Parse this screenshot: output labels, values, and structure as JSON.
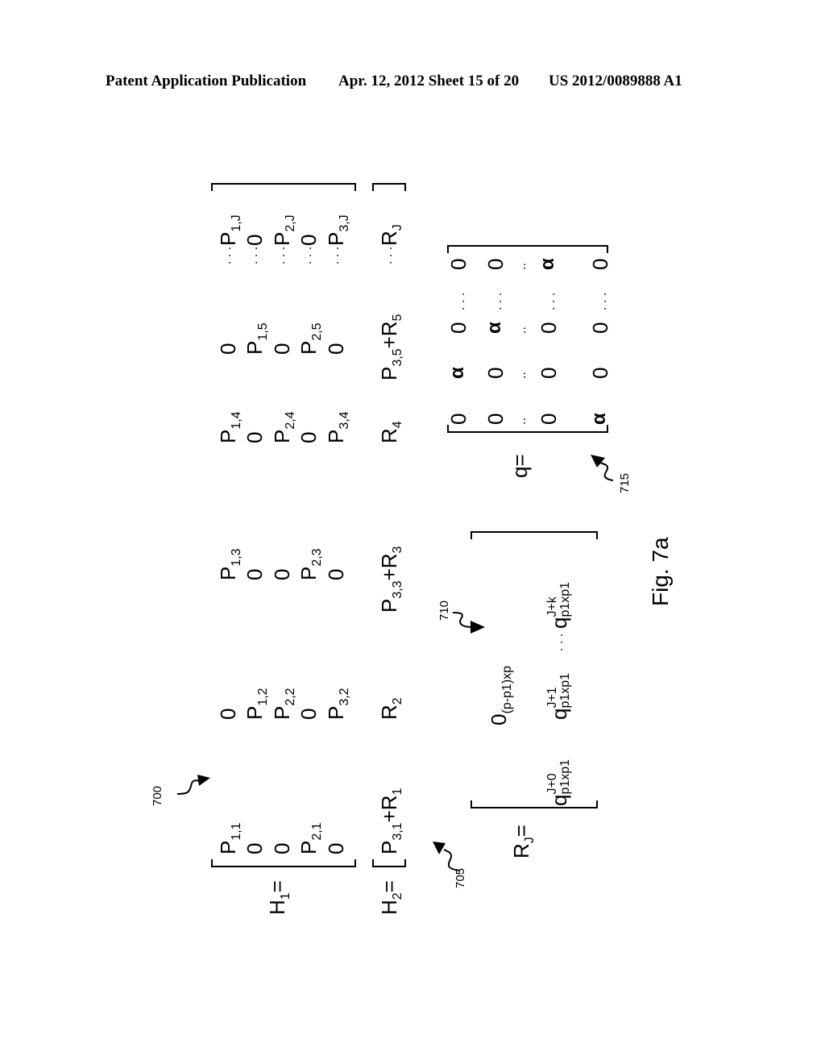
{
  "header": {
    "left": "Patent Application Publication",
    "center": "Apr. 12, 2012  Sheet 15 of 20",
    "right": "US 2012/0089888 A1"
  },
  "figure": {
    "caption": "Fig. 7a",
    "refs": {
      "r700": "700",
      "r705": "705",
      "r710": "710",
      "r715": "715"
    },
    "h1": {
      "label": "H",
      "label_sub": "1",
      "eq": "=",
      "columns": [
        [
          {
            "b": "P",
            "s": "1,1"
          },
          {
            "b": "0",
            "s": ""
          },
          {
            "b": "0",
            "s": ""
          },
          {
            "b": "P",
            "s": "2,1"
          },
          {
            "b": "0",
            "s": ""
          }
        ],
        [
          {
            "b": "0",
            "s": ""
          },
          {
            "b": "P",
            "s": "1,2"
          },
          {
            "b": "P",
            "s": "2,2"
          },
          {
            "b": "0",
            "s": ""
          },
          {
            "b": "P",
            "s": "3,2"
          }
        ],
        [
          {
            "b": "P",
            "s": "1,3"
          },
          {
            "b": "0",
            "s": ""
          },
          {
            "b": "0",
            "s": ""
          },
          {
            "b": "P",
            "s": "2,3"
          },
          {
            "b": "0",
            "s": ""
          }
        ],
        [
          {
            "b": "P",
            "s": "1,4"
          },
          {
            "b": "0",
            "s": ""
          },
          {
            "b": "P",
            "s": "2,4"
          },
          {
            "b": "0",
            "s": ""
          },
          {
            "b": "P",
            "s": "3,4"
          }
        ],
        [
          {
            "b": "0",
            "s": ""
          },
          {
            "b": "P",
            "s": "1,5"
          },
          {
            "b": "0",
            "s": ""
          },
          {
            "b": "P",
            "s": "2,5"
          },
          {
            "b": "0",
            "s": ""
          }
        ],
        [
          {
            "b": "P",
            "s": "1,J"
          },
          {
            "b": "0",
            "s": ""
          },
          {
            "b": "P",
            "s": "2,J"
          },
          {
            "b": "0",
            "s": ""
          },
          {
            "b": "P",
            "s": "3,J"
          }
        ]
      ],
      "ellipsis": ". . ."
    },
    "h2": {
      "label": "H",
      "label_sub": "2",
      "eq": "=",
      "entries": [
        {
          "parts": [
            {
              "b": "P",
              "s": "3,1"
            },
            {
              "b": "+R",
              "s": "1"
            }
          ]
        },
        {
          "parts": [
            {
              "b": "R",
              "s": "2"
            }
          ]
        },
        {
          "parts": [
            {
              "b": "P",
              "s": "3,3"
            },
            {
              "b": "+R",
              "s": "3"
            }
          ]
        },
        {
          "parts": [
            {
              "b": "R",
              "s": "4"
            }
          ]
        },
        {
          "parts": [
            {
              "b": "P",
              "s": "3,5"
            },
            {
              "b": "+R",
              "s": "5"
            }
          ]
        },
        {
          "parts": [
            {
              "b": "R",
              "s": "J"
            }
          ]
        }
      ],
      "ellipsis": ". . ."
    },
    "rj": {
      "label": "R",
      "label_sub": "J",
      "eq": "=",
      "top_entry": {
        "b": "0",
        "s": "(p-p1)xp"
      },
      "entries": [
        {
          "b": "q",
          "sup": "J+0",
          "sub": "p1xp1"
        },
        {
          "b": "q",
          "sup": "J+1",
          "sub": "p1xp1"
        },
        {
          "b": "q",
          "sup": "J+k",
          "sub": "p1xp1"
        }
      ],
      "ellipsis": ". . ."
    },
    "q": {
      "label": "q",
      "eq": "=",
      "columns": [
        [
          "0",
          "0",
          "..",
          "0",
          "α"
        ],
        [
          "α",
          "0",
          "..",
          "0",
          "0"
        ],
        [
          "0",
          "α",
          "..",
          "0",
          "0"
        ],
        [
          "0",
          "0",
          "..",
          "α",
          "0"
        ]
      ],
      "ellipsis_row": ". . ."
    }
  }
}
